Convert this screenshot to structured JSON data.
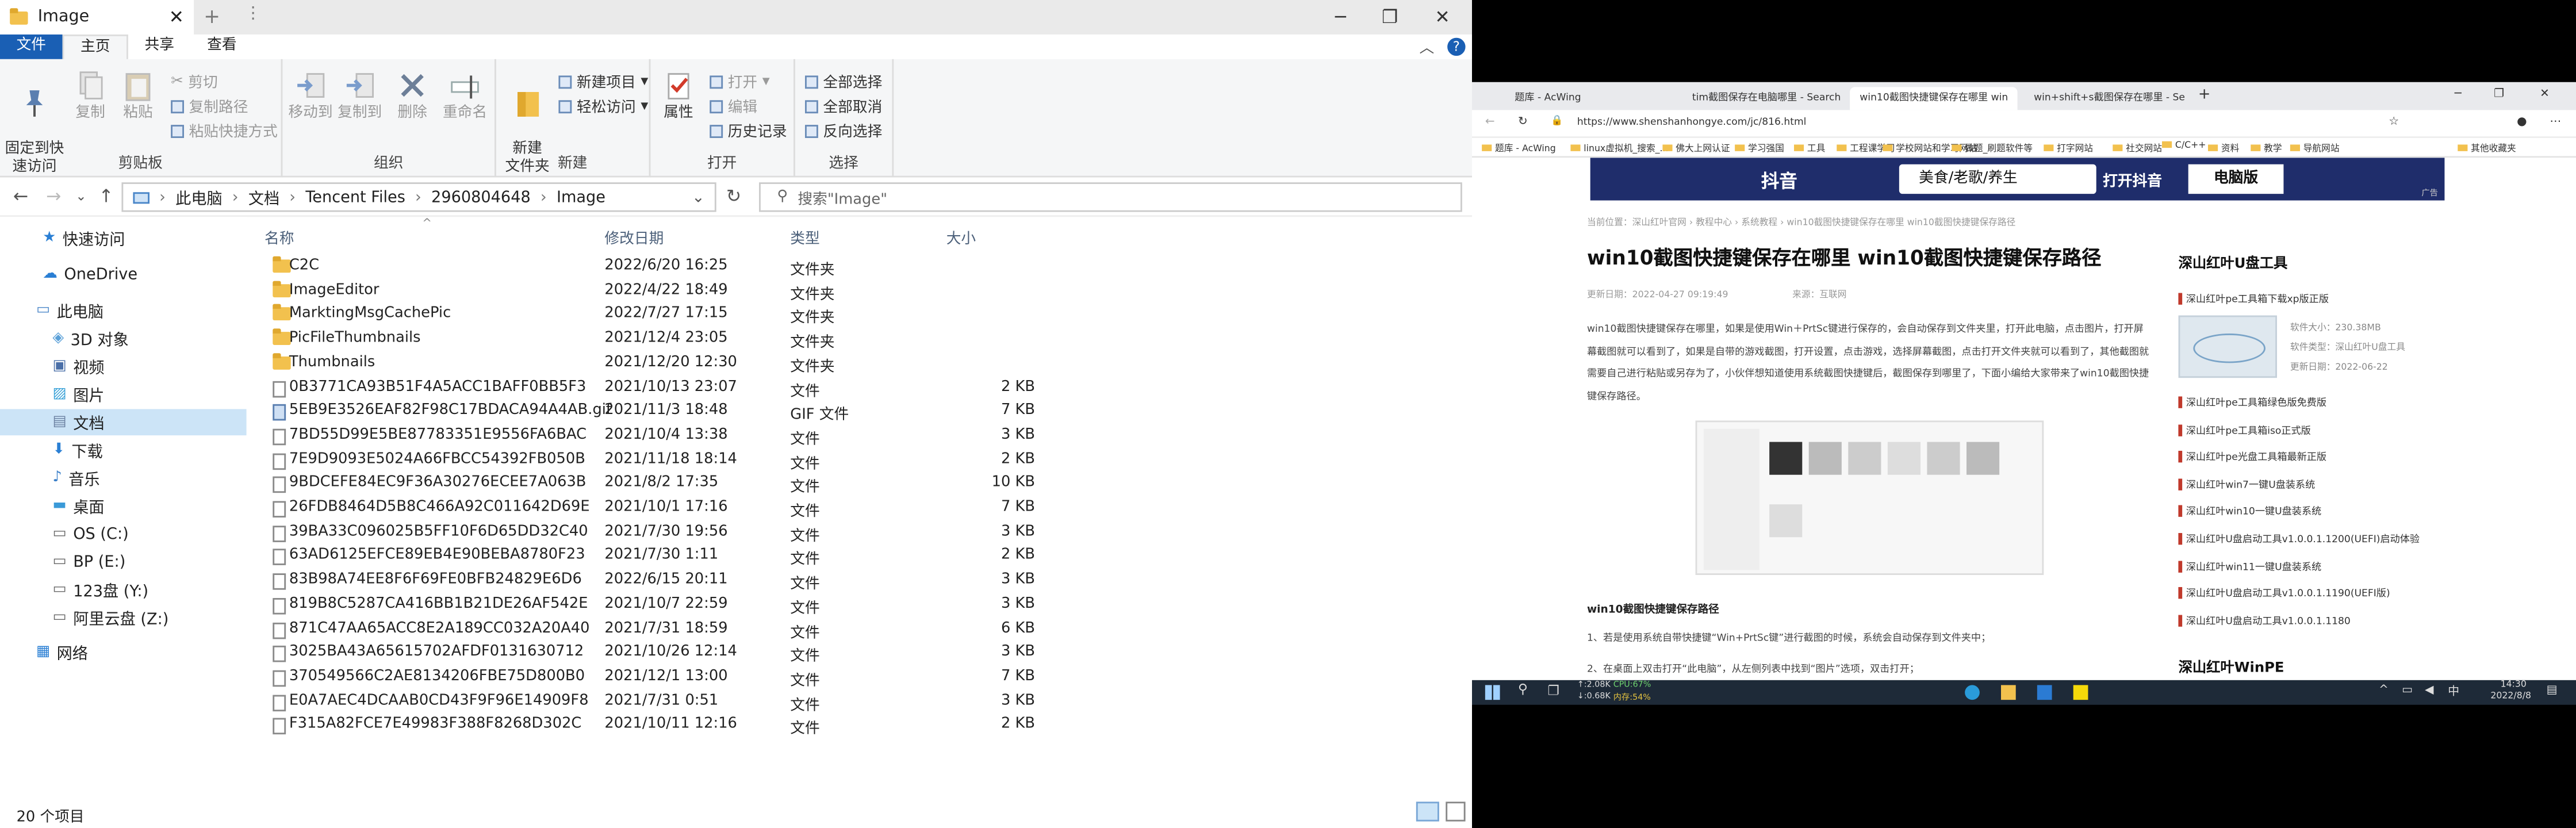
{
  "explorer": {
    "title": "Image",
    "ribbon_tabs": [
      "文件",
      "主页",
      "共享",
      "查看"
    ],
    "groups": {
      "clipboard": "剪贴板",
      "organize": "组织",
      "new": "新建",
      "open": "打开",
      "select": "选择"
    },
    "buttons": {
      "pin": "固定到快\n速访问",
      "copy": "复制",
      "paste": "粘贴",
      "cut": "剪切",
      "copy_path": "复制路径",
      "paste_shortcut": "粘贴快捷方式",
      "move_to": "移动到",
      "copy_to": "复制到",
      "delete": "删除",
      "rename": "重命名",
      "new_folder": "新建\n文件夹",
      "new_item": "新建项目",
      "easy_access": "轻松访问",
      "properties": "属性",
      "open": "打开",
      "edit": "编辑",
      "history": "历史记录",
      "select_all": "全部选择",
      "select_none": "全部取消",
      "invert": "反向选择"
    },
    "path": [
      "此电脑",
      "文档",
      "Tencent Files",
      "2960804648",
      "Image"
    ],
    "search_placeholder": "搜索\"Image\"",
    "nav": [
      "快速访问",
      "OneDrive",
      "此电脑",
      "3D 对象",
      "视频",
      "图片",
      "文档",
      "下载",
      "音乐",
      "桌面",
      "OS (C:)",
      "BP (E:)",
      "123盘 (Y:)",
      "阿里云盘 (Z:)",
      "网络"
    ],
    "columns": [
      "名称",
      "修改日期",
      "类型",
      "大小"
    ],
    "rows": [
      [
        "C2C",
        "2022/6/20 16:25",
        "文件夹",
        ""
      ],
      [
        "ImageEditor",
        "2022/4/22 18:49",
        "文件夹",
        ""
      ],
      [
        "MarktingMsgCachePic",
        "2022/7/27 17:15",
        "文件夹",
        ""
      ],
      [
        "PicFileThumbnails",
        "2021/12/4 23:05",
        "文件夹",
        ""
      ],
      [
        "Thumbnails",
        "2021/12/20 12:30",
        "文件夹",
        ""
      ],
      [
        "0B3771CA93B51F4A5ACC1BAFF0BB5F3",
        "2021/10/13 23:07",
        "文件",
        "2 KB"
      ],
      [
        "5EB9E3526EAF82F98C17BDACA94A4AB.gif",
        "2021/11/3 18:48",
        "GIF 文件",
        "7 KB"
      ],
      [
        "7BD55D99E5BE87783351E9556FA6BAC",
        "2021/10/4 13:38",
        "文件",
        "3 KB"
      ],
      [
        "7E9D9093E5024A66FBCC54392FB050B",
        "2021/11/18 18:14",
        "文件",
        "2 KB"
      ],
      [
        "9BDCEFE84EC9F36A30276ECEE7A063B",
        "2021/8/2 17:35",
        "文件",
        "10 KB"
      ],
      [
        "26FDB8464D5B8C466A92C011642D69E",
        "2021/10/1 17:16",
        "文件",
        "7 KB"
      ],
      [
        "39BA33C096025B5FF10F6D65DD32C40",
        "2021/7/30 19:56",
        "文件",
        "3 KB"
      ],
      [
        "63AD6125EFCE89EB4E90BEBA8780F23",
        "2021/7/30 1:11",
        "文件",
        "2 KB"
      ],
      [
        "83B98A74EE8F6F69FE0BFB24829E6D6",
        "2022/6/15 20:11",
        "文件",
        "3 KB"
      ],
      [
        "819B8C5287CA416BB1B21DE26AF542E",
        "2021/10/7 22:59",
        "文件",
        "3 KB"
      ],
      [
        "871C47AA65ACC8E2A189CC032A20A40",
        "2021/7/31 18:59",
        "文件",
        "6 KB"
      ],
      [
        "3025BA43A65615702AFDF0131630712",
        "2021/10/26 12:14",
        "文件",
        "3 KB"
      ],
      [
        "370549566C2AE8134206FBE75D800B0",
        "2021/12/1 13:00",
        "文件",
        "7 KB"
      ],
      [
        "E0A7AEC4DCAAB0CD43F9F96E14909F8",
        "2021/7/31 0:51",
        "文件",
        "3 KB"
      ],
      [
        "F315A82FCE7E49983F388F8268D302C",
        "2021/10/11 12:16",
        "文件",
        "2 KB"
      ]
    ],
    "status": "20 个项目"
  },
  "browser": {
    "tabs": [
      "题库 - AcWing",
      "tim截图保存在电脑哪里 - Search",
      "win10截图快捷键保存在哪里 win",
      "win+shift+s截图保存在哪里 - Se"
    ],
    "url": "https://www.shenshanhongye.com/jc/816.html",
    "favorites": [
      "题库 - AcWing",
      "linux虚拟机_搜索_...",
      "佛大上网认证",
      "学习强国",
      "工具",
      "工程课学习",
      "学校网站和学习网站",
      "做题_刷题软件等",
      "打字网站",
      "社交网站",
      "C/C++",
      "资料",
      "教学",
      "导航网站",
      "其他收藏夹"
    ],
    "banner": {
      "brand": "抖音",
      "text": "美食/老歌/养生",
      "btn1": "打开抖音",
      "btn2": "电脑版",
      "ad": "广告"
    },
    "crumb": "当前位置：深山红叶官网 › 教程中心 › 系统教程 › win10截图快捷键保存在哪里 win10截图快捷键保存路径",
    "title": "win10截图快捷键保存在哪里 win10截图快捷键保存路径",
    "meta_date": "更新日期：2022-04-27 09:19:49",
    "meta_src": "来源：互联网",
    "paragraph": "win10截图快捷键保存在哪里，如果是使用Win＋PrtSc键进行保存的，会自动保存到文件夹里，打开此电脑，点击图片，打开屏幕截图就可以看到了，如果是自带的游戏截图，打开设置，点击游戏，选择屏幕截图，点击打开文件夹就可以看到了，其他截图就需要自己进行粘贴或另存为了，小伙伴想知道使用系统截图快捷键后，截图保存到哪里了，下面小编给大家带来了win10截图快捷键保存路径。",
    "subhead": "win10截图快捷键保存路径",
    "step1": "1、若是使用系统自带快捷键“Win+PrtSc键”进行截图的时候，系统会自动保存到文件夹中；",
    "step2": "2、在桌面上双击打开“此电脑”，从左侧列表中找到“图片”选项，双击打开；",
    "side_title": "深山红叶U盘工具",
    "side_first": "深山红叶pe工具箱下载xp版正版",
    "side_meta": [
      "软件大小：230.38MB",
      "软件类型：深山红叶U盘工具",
      "更新日期：2022-06-22"
    ],
    "side_links": [
      "深山红叶pe工具箱绿色版免费版",
      "深山红叶pe工具箱iso正式版",
      "深山红叶pe光盘工具箱最新正版",
      "深山红叶win7一键U盘装系统",
      "深山红叶win10一键U盘装系统",
      "深山红叶U盘启动工具v1.0.0.1.1200(UEFI)启动体验",
      "深山红叶win11一键U盘装系统",
      "深山红叶U盘启动工具v1.0.0.1.1190(UEFI版)",
      "深山红叶U盘启动工具v1.0.0.1.1180"
    ],
    "side_title2": "深山红叶WinPE"
  },
  "taskbar": {
    "net_up": "↑:2.08K",
    "net_down": "↓:0.68K",
    "cpu": "CPU:67%",
    "mem": "内存:54%",
    "time": "14:30",
    "date": "2022/8/8"
  },
  "colors": {
    "accent": "#1a5fb4",
    "folder": "#f2c14e",
    "selection": "#cce4f7",
    "banner": "#1f2d6b",
    "link": "#c0392b"
  }
}
